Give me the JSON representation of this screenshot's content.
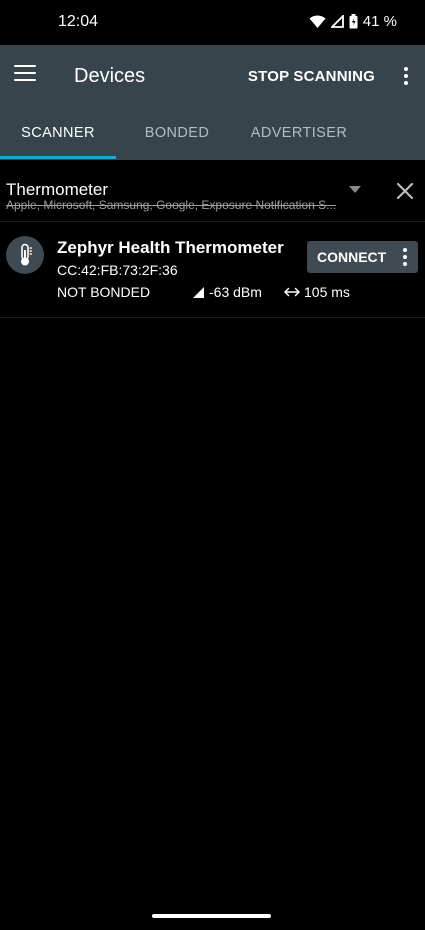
{
  "status": {
    "time": "12:04",
    "battery": "41 %"
  },
  "app_bar": {
    "title": "Devices",
    "stop_label": "STOP SCANNING"
  },
  "tabs": [
    {
      "label": "SCANNER",
      "active": true
    },
    {
      "label": "BONDED",
      "active": false
    },
    {
      "label": "ADVERTISER",
      "active": false
    }
  ],
  "filter": {
    "text": "Thermometer",
    "subtext": "Apple, Microsoft, Samsung, Google, Exposure Notification S..."
  },
  "devices": [
    {
      "name": "Zephyr Health Thermometer",
      "mac": "CC:42:FB:73:2F:36",
      "bond": "NOT BONDED",
      "rssi": "-63 dBm",
      "interval": "105 ms",
      "connect_label": "CONNECT",
      "icon": "thermometer-icon"
    }
  ],
  "colors": {
    "app_bar": "#37444c",
    "tab_indicator": "#1aa6d8",
    "background": "#000000",
    "connect_bg": "#3f4a52"
  }
}
